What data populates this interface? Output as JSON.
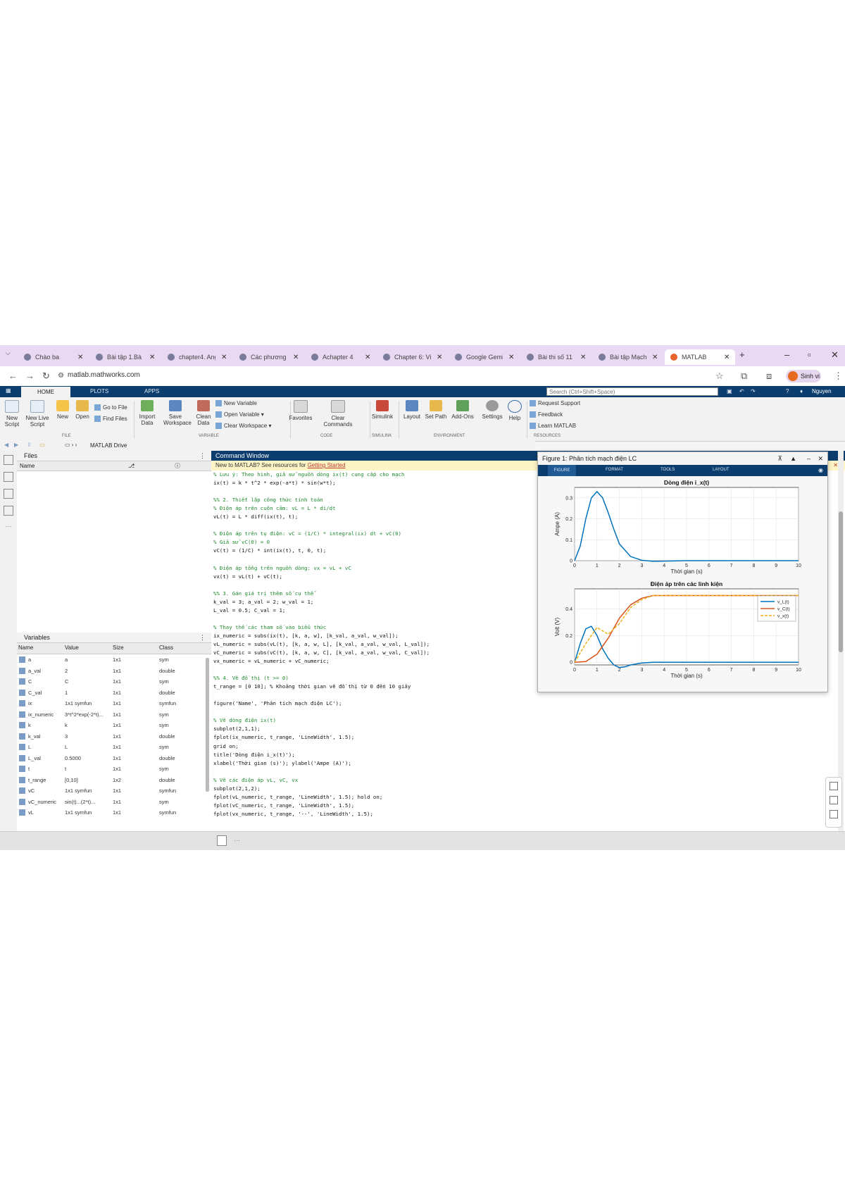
{
  "browser": {
    "tabs": [
      {
        "label": "Chào ba",
        "active": false
      },
      {
        "label": "Bài tập 1.Bà",
        "active": false
      },
      {
        "label": "chapter4. Ang",
        "active": false
      },
      {
        "label": "Các phương",
        "active": false
      },
      {
        "label": "Achapter 4",
        "active": false
      },
      {
        "label": "Chapter 6: Vi",
        "active": false
      },
      {
        "label": "Google Gemi",
        "active": false
      },
      {
        "label": "Bài thi số 11",
        "active": false
      },
      {
        "label": "Bài tập Mạch",
        "active": false
      },
      {
        "label": "MATLAB",
        "active": true
      }
    ],
    "new_tab": "+",
    "url": "matlab.mathworks.com",
    "profile_name": "Sinh vi"
  },
  "matlab": {
    "tabs": [
      "HOME",
      "PLOTS",
      "APPS"
    ],
    "search_placeholder": "Search (Ctrl+Shift+Space)",
    "user": "Nguyen",
    "ribbon": {
      "file": {
        "label": "FILE",
        "buttons": [
          "New Script",
          "New Live Script",
          "New",
          "Open"
        ],
        "small": [
          "Go to File",
          "Find Files"
        ]
      },
      "variable": {
        "label": "VARIABLE",
        "buttons": [
          "Import Data",
          "Save Workspace",
          "Clean Data"
        ],
        "small": [
          "New Variable",
          "Open Variable",
          "Clear Workspace"
        ]
      },
      "code": {
        "label": "CODE",
        "buttons": [
          "Favorites",
          "Clear Commands"
        ]
      },
      "simulink": {
        "label": "SIMULINK",
        "buttons": [
          "Simulink"
        ]
      },
      "environment": {
        "label": "ENVIRONMENT",
        "buttons": [
          "Layout",
          "Set Path",
          "Add-Ons",
          "Settings",
          "Help"
        ]
      },
      "resources": {
        "label": "RESOURCES",
        "small": [
          "Request Support",
          "Feedback",
          "Learn MATLAB"
        ]
      }
    },
    "path": "MATLAB Drive",
    "files_panel": {
      "title": "Files",
      "col_name": "Name"
    },
    "workspace": {
      "title": "Variables",
      "columns": [
        "Name",
        "Value",
        "Size",
        "Class"
      ],
      "rows": [
        {
          "name": "a",
          "value": "a",
          "size": "1x1",
          "cls": "sym"
        },
        {
          "name": "a_val",
          "value": "2",
          "size": "1x1",
          "cls": "double"
        },
        {
          "name": "C",
          "value": "C",
          "size": "1x1",
          "cls": "sym"
        },
        {
          "name": "C_val",
          "value": "1",
          "size": "1x1",
          "cls": "double"
        },
        {
          "name": "ix",
          "value": "1x1 symfun",
          "size": "1x1",
          "cls": "symfun"
        },
        {
          "name": "ix_numeric",
          "value": "3*t^2*exp(-2*t)...",
          "size": "1x1",
          "cls": "sym"
        },
        {
          "name": "k",
          "value": "k",
          "size": "1x1",
          "cls": "sym"
        },
        {
          "name": "k_val",
          "value": "3",
          "size": "1x1",
          "cls": "double"
        },
        {
          "name": "L",
          "value": "L",
          "size": "1x1",
          "cls": "sym"
        },
        {
          "name": "L_val",
          "value": "0.5000",
          "size": "1x1",
          "cls": "double"
        },
        {
          "name": "t",
          "value": "t",
          "size": "1x1",
          "cls": "sym"
        },
        {
          "name": "t_range",
          "value": "[0,10]",
          "size": "1x2",
          "cls": "double"
        },
        {
          "name": "vC",
          "value": "1x1 symfun",
          "size": "1x1",
          "cls": "symfun"
        },
        {
          "name": "vC_numeric",
          "value": "sin(t)...(2*t)...",
          "size": "1x1",
          "cls": "sym"
        },
        {
          "name": "vL",
          "value": "1x1 symfun",
          "size": "1x1",
          "cls": "symfun"
        }
      ]
    },
    "command_window": {
      "title": "Command Window",
      "notice_prefix": "New to MATLAB? See resources for ",
      "notice_link": "Getting Started",
      "lines": [
        {
          "t": "% Lưu ý: Theo hình, giả sử nguồn dòng ix(t) cung cấp cho mạch",
          "c": true
        },
        {
          "t": "ix(t) = k * t^2 * exp(-a*t) * sin(w*t);",
          "c": false
        },
        {
          "t": "",
          "c": false
        },
        {
          "t": "%% 2. Thiết lập công thức tính toán",
          "c": true
        },
        {
          "t": "% Điện áp trên cuộn cảm: vL = L * di/dt",
          "c": true
        },
        {
          "t": "vL(t) = L * diff(ix(t), t);",
          "c": false
        },
        {
          "t": "",
          "c": false
        },
        {
          "t": "% Điện áp trên tụ điện: vC = (1/C) * integral(ix) dt + vC(0)",
          "c": true
        },
        {
          "t": "% Giả sử vC(0) = 0",
          "c": true
        },
        {
          "t": "vC(t) = (1/C) * int(ix(t), t, 0, t);",
          "c": false
        },
        {
          "t": "",
          "c": false
        },
        {
          "t": "% Điện áp tổng trên nguồn dòng: vx = vL + vC",
          "c": true
        },
        {
          "t": "vx(t) = vL(t) + vC(t);",
          "c": false
        },
        {
          "t": "",
          "c": false
        },
        {
          "t": "%% 3. Gán giá trị thêm số cụ thể",
          "c": true
        },
        {
          "t": "k_val = 3; a_val = 2; w_val = 1;",
          "c": false
        },
        {
          "t": "L_val = 0.5; C_val = 1;",
          "c": false
        },
        {
          "t": "",
          "c": false
        },
        {
          "t": "% Thay thế các tham số vào biểu thức",
          "c": true
        },
        {
          "t": "ix_numeric = subs(ix(t), [k, a, w], [k_val, a_val, w_val]);",
          "c": false
        },
        {
          "t": "vL_numeric = subs(vL(t), [k, a, w, L], [k_val, a_val, w_val, L_val]);",
          "c": false
        },
        {
          "t": "vC_numeric = subs(vC(t), [k, a, w, C], [k_val, a_val, w_val, C_val]);",
          "c": false
        },
        {
          "t": "vx_numeric = vL_numeric + vC_numeric;",
          "c": false
        },
        {
          "t": "",
          "c": false
        },
        {
          "t": "%% 4. Vẽ đồ thị (t >= 0)",
          "c": true
        },
        {
          "t": "t_range = [0 10]; % Khoảng thời gian vẽ đồ thị từ 0 đến 10 giây",
          "c": false
        },
        {
          "t": "",
          "c": false
        },
        {
          "t": "figure('Name', 'Phân tích mạch điện LC');",
          "c": false
        },
        {
          "t": "",
          "c": false
        },
        {
          "t": "% Vẽ dòng điện ix(t)",
          "c": true
        },
        {
          "t": "subplot(2,1,1);",
          "c": false
        },
        {
          "t": "fplot(ix_numeric, t_range, 'LineWidth', 1.5);",
          "c": false
        },
        {
          "t": "grid on;",
          "c": false
        },
        {
          "t": "title('Dòng điện i_x(t)');",
          "c": false
        },
        {
          "t": "xlabel('Thời gian (s)'); ylabel('Ampe (A)');",
          "c": false
        },
        {
          "t": "",
          "c": false
        },
        {
          "t": "% Vẽ các điện áp vL, vC, vx",
          "c": true
        },
        {
          "t": "subplot(2,1,2);",
          "c": false
        },
        {
          "t": "fplot(vL_numeric, t_range, 'LineWidth', 1.5); hold on;",
          "c": false
        },
        {
          "t": "fplot(vC_numeric, t_range, 'LineWidth', 1.5);",
          "c": false
        },
        {
          "t": "fplot(vx_numeric, t_range, '--', 'LineWidth', 1.5);",
          "c": false
        }
      ]
    },
    "figure": {
      "title": "Figure 1: Phân tích mạch điện LC",
      "tabs": [
        "FIGURE",
        "FORMAT",
        "TOOLS",
        "LAYOUT"
      ],
      "selected_tab": "FIGURE"
    }
  },
  "chart_data": [
    {
      "type": "line",
      "title": "Dòng điện i_x(t)",
      "xlabel": "Thời gian (s)",
      "ylabel": "Ampe (A)",
      "xlim": [
        0,
        10
      ],
      "ylim": [
        0,
        0.35
      ],
      "xticks": [
        0,
        1,
        2,
        3,
        4,
        5,
        6,
        7,
        8,
        9,
        10
      ],
      "yticks": [
        0,
        0.1,
        0.2,
        0.3
      ],
      "grid": true,
      "series": [
        {
          "color": "#0072BD",
          "style": "solid",
          "x": [
            0,
            0.25,
            0.5,
            0.75,
            1.0,
            1.25,
            1.5,
            1.75,
            2.0,
            2.5,
            3.0,
            3.5,
            4.0,
            5.0,
            6.0,
            7.0,
            8.0,
            9.0,
            10.0
          ],
          "y": [
            0,
            0.07,
            0.2,
            0.3,
            0.33,
            0.3,
            0.23,
            0.15,
            0.08,
            0.02,
            0.002,
            -0.003,
            -0.002,
            0,
            0,
            0,
            0,
            0,
            0
          ]
        }
      ]
    },
    {
      "type": "line",
      "title": "Điện áp trên các linh kiện",
      "xlabel": "Thời gian (s)",
      "ylabel": "Volt (V)",
      "xlim": [
        0,
        10
      ],
      "ylim": [
        -0.02,
        0.55
      ],
      "xticks": [
        0,
        1,
        2,
        3,
        4,
        5,
        6,
        7,
        8,
        9,
        10
      ],
      "yticks": [
        0,
        0.2,
        0.4
      ],
      "grid": true,
      "legend": "top-right",
      "series": [
        {
          "name": "v_L(t)",
          "color": "#0072BD",
          "style": "solid",
          "x": [
            0,
            0.25,
            0.5,
            0.75,
            1.0,
            1.25,
            1.5,
            1.75,
            2.0,
            2.25,
            2.5,
            3.0,
            3.5,
            4.0,
            5.0,
            6.0,
            7.0,
            8.0,
            9.0,
            10.0
          ],
          "y": [
            0,
            0.14,
            0.25,
            0.27,
            0.2,
            0.1,
            0.03,
            -0.02,
            -0.04,
            -0.035,
            -0.02,
            -0.005,
            0,
            0,
            0,
            0,
            0,
            0,
            0,
            0
          ]
        },
        {
          "name": "v_C(t)",
          "color": "#D95319",
          "style": "solid",
          "x": [
            0,
            0.5,
            1.0,
            1.5,
            2.0,
            2.5,
            3.0,
            3.5,
            4.0,
            5.0,
            6.0,
            7.0,
            8.0,
            9.0,
            10.0
          ],
          "y": [
            0,
            0.005,
            0.06,
            0.18,
            0.33,
            0.43,
            0.48,
            0.5,
            0.5,
            0.5,
            0.5,
            0.5,
            0.5,
            0.5,
            0.5
          ]
        },
        {
          "name": "v_x(t)",
          "color": "#EDB120",
          "style": "dashed",
          "x": [
            0,
            0.5,
            1.0,
            1.5,
            2.0,
            2.5,
            3.0,
            3.5,
            4.0,
            5.0,
            6.0,
            7.0,
            8.0,
            9.0,
            10.0
          ],
          "y": [
            0,
            0.14,
            0.26,
            0.21,
            0.29,
            0.41,
            0.47,
            0.5,
            0.5,
            0.5,
            0.5,
            0.5,
            0.5,
            0.5,
            0.5
          ]
        }
      ]
    }
  ]
}
